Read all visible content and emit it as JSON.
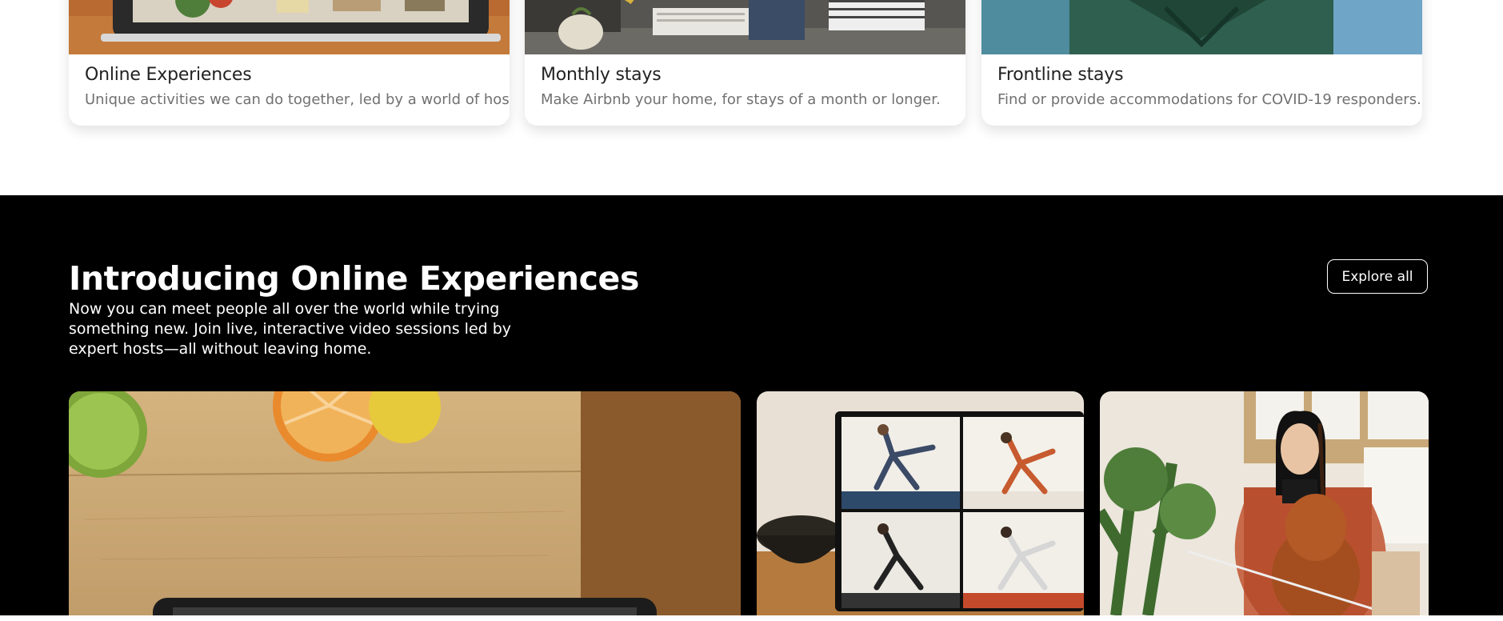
{
  "cards": [
    {
      "title": "Online Experiences",
      "description": "Unique activities we can do together, led by a world of hosts."
    },
    {
      "title": "Monthly stays",
      "description": "Make Airbnb your home, for stays of a month or longer."
    },
    {
      "title": "Frontline stays",
      "description": "Find or provide accommodations for COVID-19 responders."
    }
  ],
  "online_section": {
    "title": "Introducing Online Experiences",
    "subtitle": "Now you can meet people all over the world while trying something new. Join live, interactive video sessions led by expert hosts—all without leaving home.",
    "explore_label": "Explore all"
  },
  "colors": {
    "dark_background": "#000000",
    "card_title": "#222222",
    "card_description": "#717171"
  }
}
